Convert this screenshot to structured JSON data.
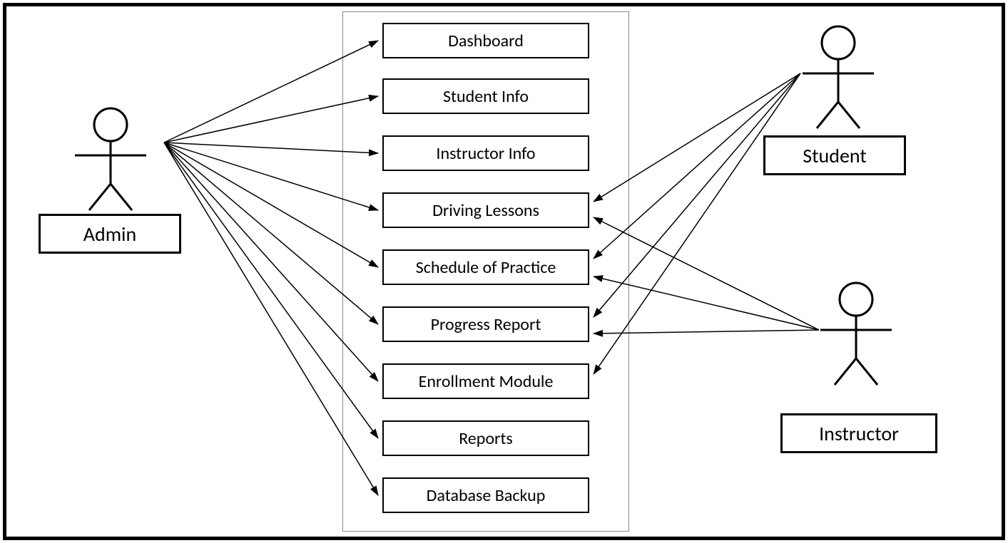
{
  "actors": {
    "admin": "Admin",
    "student": "Student",
    "instructor": "Instructor"
  },
  "usecases": {
    "dashboard": "Dashboard",
    "student_info": "Student Info",
    "instructor_info": "Instructor Info",
    "driving_lessons": "Driving Lessons",
    "schedule_of_practice": "Schedule of Practice",
    "progress_report": "Progress Report",
    "enrollment_module": "Enrollment Module",
    "reports": "Reports",
    "database_backup": "Database Backup"
  },
  "associations": {
    "admin": [
      "dashboard",
      "student_info",
      "instructor_info",
      "driving_lessons",
      "schedule_of_practice",
      "progress_report",
      "enrollment_module",
      "reports",
      "database_backup"
    ],
    "student": [
      "driving_lessons",
      "schedule_of_practice",
      "progress_report",
      "enrollment_module"
    ],
    "instructor": [
      "driving_lessons",
      "schedule_of_practice",
      "progress_report"
    ]
  }
}
